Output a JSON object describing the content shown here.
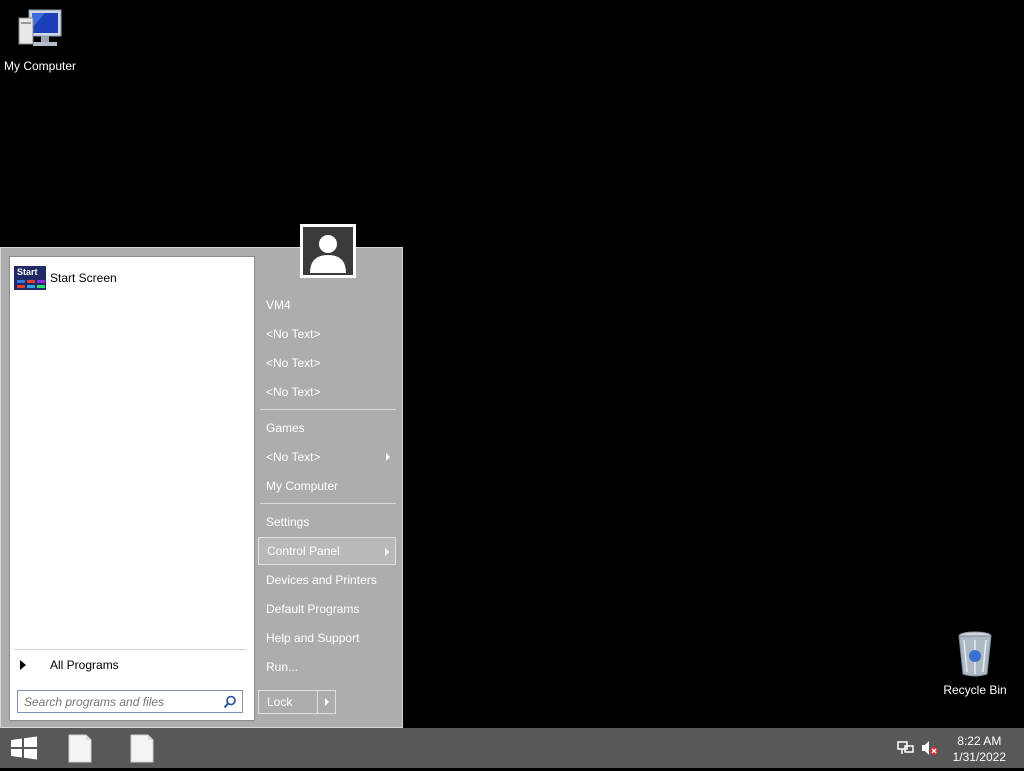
{
  "desktop": {
    "my_computer_label": "My Computer",
    "recycle_bin_label": "Recycle Bin"
  },
  "start_menu": {
    "pinned": [
      {
        "label": "Start Screen",
        "tile_text": "Start"
      }
    ],
    "all_programs_label": "All Programs",
    "search_placeholder": "Search programs and files",
    "right_items": [
      {
        "label": "VM4"
      },
      {
        "label": "<No Text>"
      },
      {
        "label": "<No Text>"
      },
      {
        "label": "<No Text>"
      },
      {
        "label": "Games"
      },
      {
        "label": "<No Text>",
        "has_submenu": true
      },
      {
        "label": "My Computer"
      },
      {
        "label": "Settings"
      },
      {
        "label": "Control Panel",
        "has_submenu": true,
        "highlighted": true
      },
      {
        "label": "Devices and Printers"
      },
      {
        "label": "Default Programs"
      },
      {
        "label": "Help and Support"
      },
      {
        "label": "Run..."
      }
    ],
    "lock_label": "Lock"
  },
  "taskbar": {
    "time": "8:22 AM",
    "date": "1/31/2022"
  },
  "colors": {
    "menu_bg": "#adadad",
    "taskbar_bg": "#585858",
    "desktop_bg": "#000000"
  }
}
